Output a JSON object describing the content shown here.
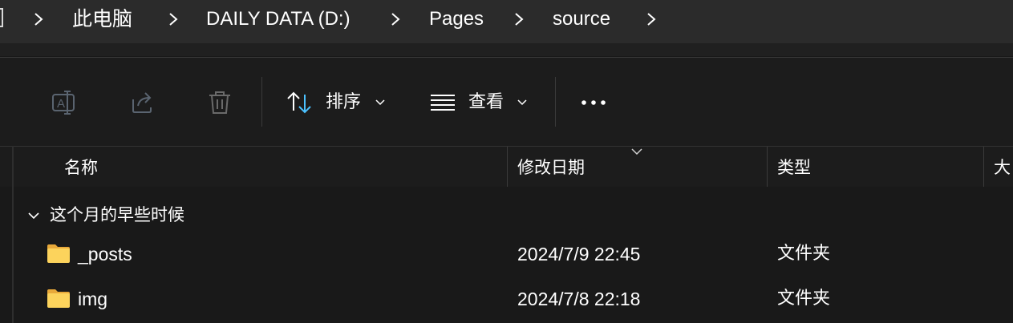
{
  "breadcrumb": {
    "items": [
      "此电脑",
      "DAILY DATA (D:)",
      "Pages",
      "source"
    ]
  },
  "toolbar": {
    "sort_label": "排序",
    "view_label": "查看",
    "more_label": "•••",
    "icons": [
      "rename-icon",
      "share-icon",
      "delete-icon",
      "sort-icon",
      "view-icon",
      "chevron-down-icon",
      "more-icon"
    ],
    "accent_color": "#4cc2ff"
  },
  "columns": {
    "name": "名称",
    "modified": "修改日期",
    "type": "类型",
    "size": "大"
  },
  "group": {
    "label": "这个月的早些时候"
  },
  "files": [
    {
      "name": "_posts",
      "modified": "2024/7/9 22:45",
      "type": "文件夹"
    },
    {
      "name": "img",
      "modified": "2024/7/8 22:18",
      "type": "文件夹"
    }
  ]
}
